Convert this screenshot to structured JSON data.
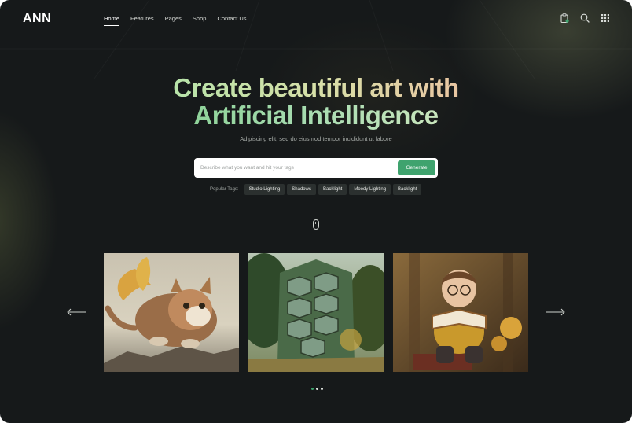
{
  "brand": {
    "logo": "ANN"
  },
  "nav": {
    "items": [
      {
        "label": "Home",
        "active": true
      },
      {
        "label": "Features",
        "active": false
      },
      {
        "label": "Pages",
        "active": false
      },
      {
        "label": "Shop",
        "active": false
      },
      {
        "label": "Contact Us",
        "active": false
      }
    ]
  },
  "header_icons": [
    "clipboard-icon",
    "search-icon",
    "grid-menu-icon"
  ],
  "hero": {
    "title_part1": "Create beautiful art with",
    "title_part2": "Artificial Intelligence",
    "subtitle": "Adipiscing elit, sed do eiusmod tempor incididunt ut labore"
  },
  "search": {
    "placeholder": "Describe what you want and hit your tags",
    "value": "",
    "button_label": "Generate"
  },
  "tags": {
    "label": "Popular Tags:",
    "items": [
      "Studio Lighting",
      "Shadows",
      "Backlight",
      "Moody Lighting",
      "Backlight"
    ]
  },
  "gallery": {
    "images": [
      {
        "name": "flying-cat-with-butterfly-wings-image"
      },
      {
        "name": "overgrown-green-building-image"
      },
      {
        "name": "boy-reading-book-image"
      }
    ],
    "prev_icon": "arrow-left-icon",
    "next_icon": "arrow-right-icon",
    "pagination": {
      "count": 3,
      "active_index": 0
    }
  },
  "colors": {
    "background": "#16191a",
    "accent": "#3fa36e",
    "tag_background": "#2b302f"
  }
}
